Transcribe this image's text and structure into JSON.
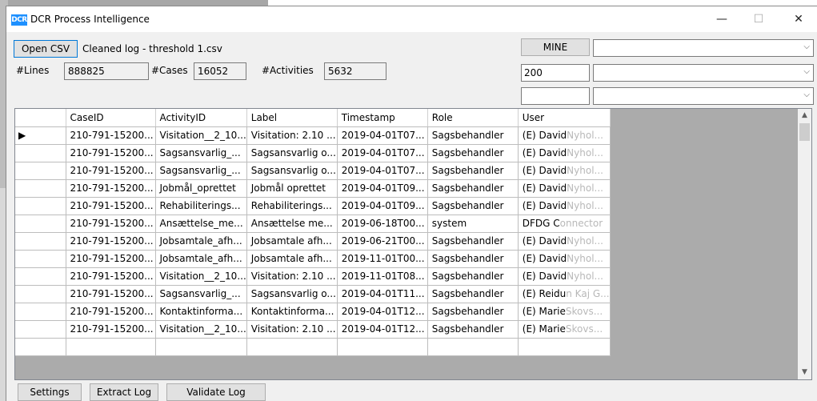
{
  "window": {
    "title": "DCR Process Intelligence",
    "logo_text": "DCR",
    "controls": {
      "minimize": "—",
      "maximize": "☐",
      "close": "✕"
    }
  },
  "toolbar": {
    "open_csv_label": "Open CSV",
    "file_name": "Cleaned log - threshold 1.csv",
    "mine_label": "MINE",
    "threshold_value": "200",
    "empty_input_value": ""
  },
  "stats": {
    "lines_label": "#Lines",
    "lines_value": "888825",
    "cases_label": "#Cases",
    "cases_value": "16052",
    "activities_label": "#Activities",
    "activities_value": "5632"
  },
  "grid": {
    "columns": [
      "CaseID",
      "ActivityID",
      "Label",
      "Timestamp",
      "Role",
      "User"
    ],
    "rows": [
      [
        "210-791-15200...",
        "Visitation__2_10...",
        "Visitation: 2.10 ...",
        "2019-04-01T07...",
        "Sagsbehandler",
        "(E) David",
        "Nyhol..."
      ],
      [
        "210-791-15200...",
        "Sagsansvarlig_...",
        "Sagsansvarlig o...",
        "2019-04-01T07...",
        "Sagsbehandler",
        "(E) David",
        "Nyhol..."
      ],
      [
        "210-791-15200...",
        "Sagsansvarlig_...",
        "Sagsansvarlig o...",
        "2019-04-01T07...",
        "Sagsbehandler",
        "(E) David",
        "Nyhol..."
      ],
      [
        "210-791-15200...",
        "Jobmål_oprettet",
        "Jobmål oprettet",
        "2019-04-01T09...",
        "Sagsbehandler",
        "(E) David",
        "Nyhol..."
      ],
      [
        "210-791-15200...",
        "Rehabiliterings...",
        "Rehabiliterings...",
        "2019-04-01T09...",
        "Sagsbehandler",
        "(E) David",
        "Nyhol..."
      ],
      [
        "210-791-15200...",
        "Ansættelse_me...",
        "Ansættelse me...",
        "2019-06-18T00...",
        "system",
        "DFDG C",
        "onnector"
      ],
      [
        "210-791-15200...",
        "Jobsamtale_afh...",
        "Jobsamtale afh...",
        "2019-06-21T00...",
        "Sagsbehandler",
        "(E) David",
        "Nyhol..."
      ],
      [
        "210-791-15200...",
        "Jobsamtale_afh...",
        "Jobsamtale afh...",
        "2019-11-01T00...",
        "Sagsbehandler",
        "(E) David",
        "Nyhol..."
      ],
      [
        "210-791-15200...",
        "Visitation__2_10...",
        "Visitation: 2.10 ...",
        "2019-11-01T08...",
        "Sagsbehandler",
        "(E) David",
        "Nyhol..."
      ],
      [
        "210-791-15200...",
        "Sagsansvarlig_...",
        "Sagsansvarlig o...",
        "2019-04-01T11...",
        "Sagsbehandler",
        "(E) Reidu",
        "n Kaj G..."
      ],
      [
        "210-791-15200...",
        "Kontaktinforma...",
        "Kontaktinforma...",
        "2019-04-01T12...",
        "Sagsbehandler",
        "(E) Marie",
        "Skovs..."
      ],
      [
        "210-791-15200...",
        "Visitation__2_10...",
        "Visitation: 2.10 ...",
        "2019-04-01T12...",
        "Sagsbehandler",
        "(E) Marie",
        "Skovs..."
      ]
    ],
    "selected_row_marker": "▶"
  },
  "scrollbar": {
    "up": "▲",
    "down": "▼"
  },
  "bottom_bar": {
    "settings_label": "Settings",
    "extract_label": "Extract Log",
    "validate_label": "Validate Log"
  },
  "combo_arrow": "⌵"
}
